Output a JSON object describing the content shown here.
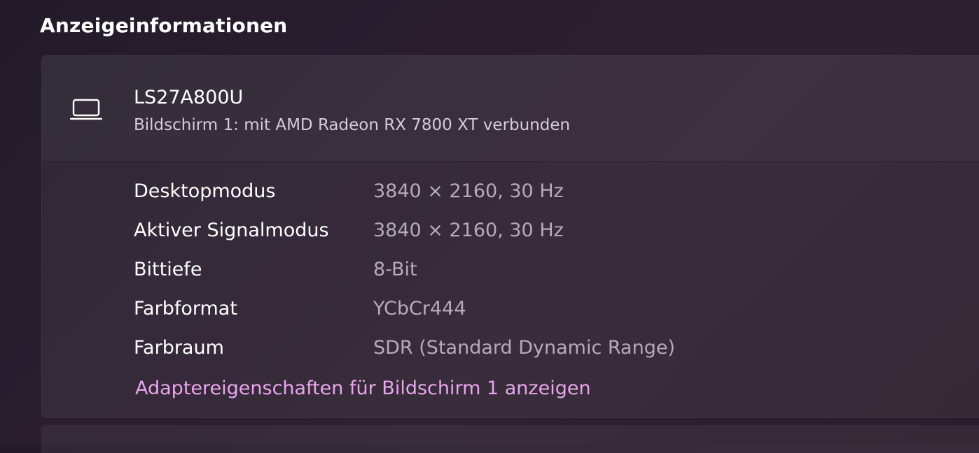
{
  "section": {
    "title": "Anzeigeinformationen"
  },
  "display": {
    "icon": "laptop-icon",
    "name": "LS27A800U",
    "subtitle": "Bildschirm 1: mit AMD Radeon RX 7800 XT verbunden"
  },
  "details": [
    {
      "label": "Desktopmodus",
      "value": "3840 × 2160, 30 Hz"
    },
    {
      "label": "Aktiver Signalmodus",
      "value": "3840 × 2160, 30 Hz"
    },
    {
      "label": "Bittiefe",
      "value": "8-Bit"
    },
    {
      "label": "Farbformat",
      "value": "YCbCr444"
    },
    {
      "label": "Farbraum",
      "value": "SDR (Standard Dynamic Range)"
    }
  ],
  "link": {
    "label": "Adaptereigenschaften für Bildschirm 1 anzeigen"
  },
  "colors": {
    "accent_link": "#e6a6ea",
    "value_text": "#b5acb7",
    "background": "#2a1e2f"
  }
}
